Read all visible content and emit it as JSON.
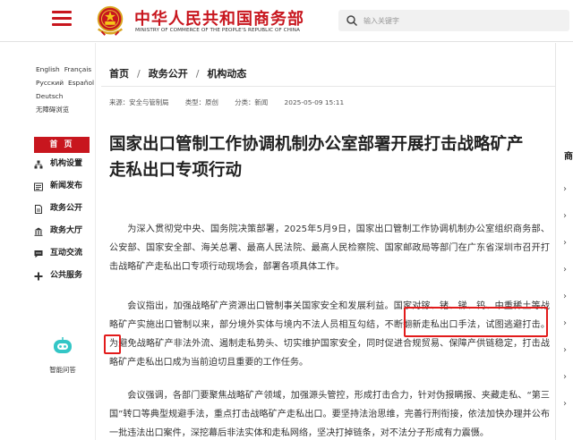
{
  "header": {
    "site_title": "中华人民共和国商务部",
    "site_subtitle": "MINISTRY OF COMMERCE OF THE PEOPLE'S REPUBLIC OF CHINA",
    "search_placeholder": "输入关键字",
    "brand_color": "#c8161e"
  },
  "sidebar": {
    "languages": [
      [
        "English",
        "Français"
      ],
      [
        "Русский",
        "Español"
      ],
      [
        "Deutsch"
      ],
      [
        "无障碍浏览"
      ]
    ],
    "home_label": "首 页",
    "items": [
      {
        "label": "机构设置",
        "icon": "org-icon"
      },
      {
        "label": "新闻发布",
        "icon": "news-icon"
      },
      {
        "label": "政务公开",
        "icon": "doc-icon"
      },
      {
        "label": "政务大厅",
        "icon": "hall-icon"
      },
      {
        "label": "互动交流",
        "icon": "chat-icon"
      },
      {
        "label": "公共服务",
        "icon": "service-icon"
      }
    ],
    "assistant_label": "智能问答"
  },
  "breadcrumb": [
    "首页",
    "政务公开",
    "机构动态"
  ],
  "meta": {
    "source": "来源：安全与管制局",
    "type": "类型：原创",
    "category": "分类：新闻",
    "date": "2025-05-09 15:11"
  },
  "article": {
    "title": "国家出口管制工作协调机制办公室部署开展打击战略矿产走私出口专项行动",
    "paragraphs": [
      "为深入贯彻党中央、国务院决策部署，2025年5月9日，国家出口管制工作协调机制办公室组织商务部、公安部、国家安全部、海关总署、最高人民法院、最高人民检察院、国家邮政局等部门在广东省深圳市召开打击战略矿产走私出口专项行动现场会，部署各项具体工作。",
      "会议指出，加强战略矿产资源出口管制事关国家安全和发展利益。国家对镓、锗、锑、钨、中重稀土等战略矿产实施出口管制以来，部分境外实体与境内不法人员相互勾结，不断翻新走私出口手法，试图逃避打击。为避免战略矿产非法外流、遏制走私势头、切实维护国家安全，同时促进合规贸易、保障产供链稳定，打击战略矿产走私出口成为当前迫切且重要的工作任务。",
      "会议强调，各部门要聚焦战略矿产领域，加强源头管控，形成打击合力，针对伪报瞒报、夹藏走私、“第三国”转口等典型规避手法，重点打击战略矿产走私出口。要坚持法治思维，完善行刑衔接，依法加快办理并公布一批违法出口案件，深挖幕后非法实体和走私网络，坚决打掉链条，对不法分子形成有力震慑。"
    ]
  },
  "right_sidebar": {
    "label": "商",
    "chevron": "›"
  }
}
